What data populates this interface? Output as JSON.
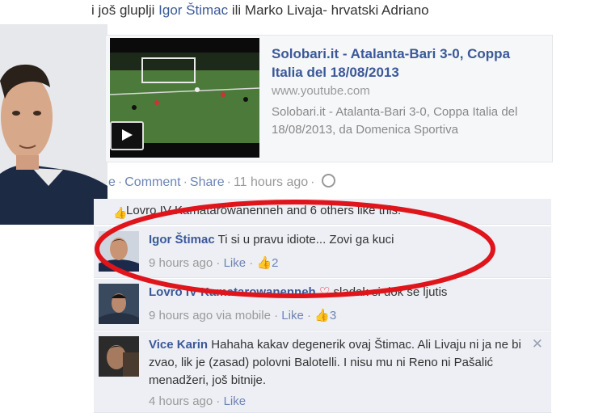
{
  "post": {
    "text_prefix": "i još gluplji ",
    "text_author": "Igor Štimac",
    "text_suffix": " ili Marko Livaja- hrvatski Adriano"
  },
  "share": {
    "title": "Solobari.it - Atalanta-Bari 3-0, Coppa Italia del 18/08/2013",
    "domain": "www.youtube.com",
    "description": "Solobari.it - Atalanta-Bari 3-0, Coppa Italia del 18/08/2013, da Domenica Sportiva"
  },
  "actions": {
    "like_fragment": "e",
    "comment": "Comment",
    "share": "Share",
    "time": "11 hours ago"
  },
  "likes_bar": {
    "text": "Lovro IV Kamatarowanenneh and 6 others like this."
  },
  "comments": [
    {
      "name": "Igor Štimac",
      "text": "Ti si u pravu idiote... Zovi ga kuci",
      "time": "9 hours ago",
      "like": "Like",
      "likes": "2",
      "via": ""
    },
    {
      "name": "Lovro IV Kamatarowanenneh",
      "text": "sladak si dok se ljutis",
      "time": "9 hours ago",
      "via": "via mobile",
      "like": "Like",
      "likes": "3"
    },
    {
      "name": "Vice Karin",
      "text": "Hahaha kakav degenerik ovaj Štimac. Ali Livaju ni ja ne bi zvao, lik je (zasad) polovni Balotelli. I nisu mu ni Reno ni Pašalić menadžeri, još bitnije.",
      "time": "4 hours ago",
      "like": "Like",
      "likes": "",
      "via": ""
    }
  ],
  "icons": {
    "thumb": "thumbs-up-icon",
    "globe": "globe-icon",
    "play": "play-icon",
    "close": "close-icon",
    "heart": "heart-icon"
  },
  "colors": {
    "link": "#3b5998",
    "comment_bg": "#edeff4",
    "highlight": "#e0141b"
  }
}
